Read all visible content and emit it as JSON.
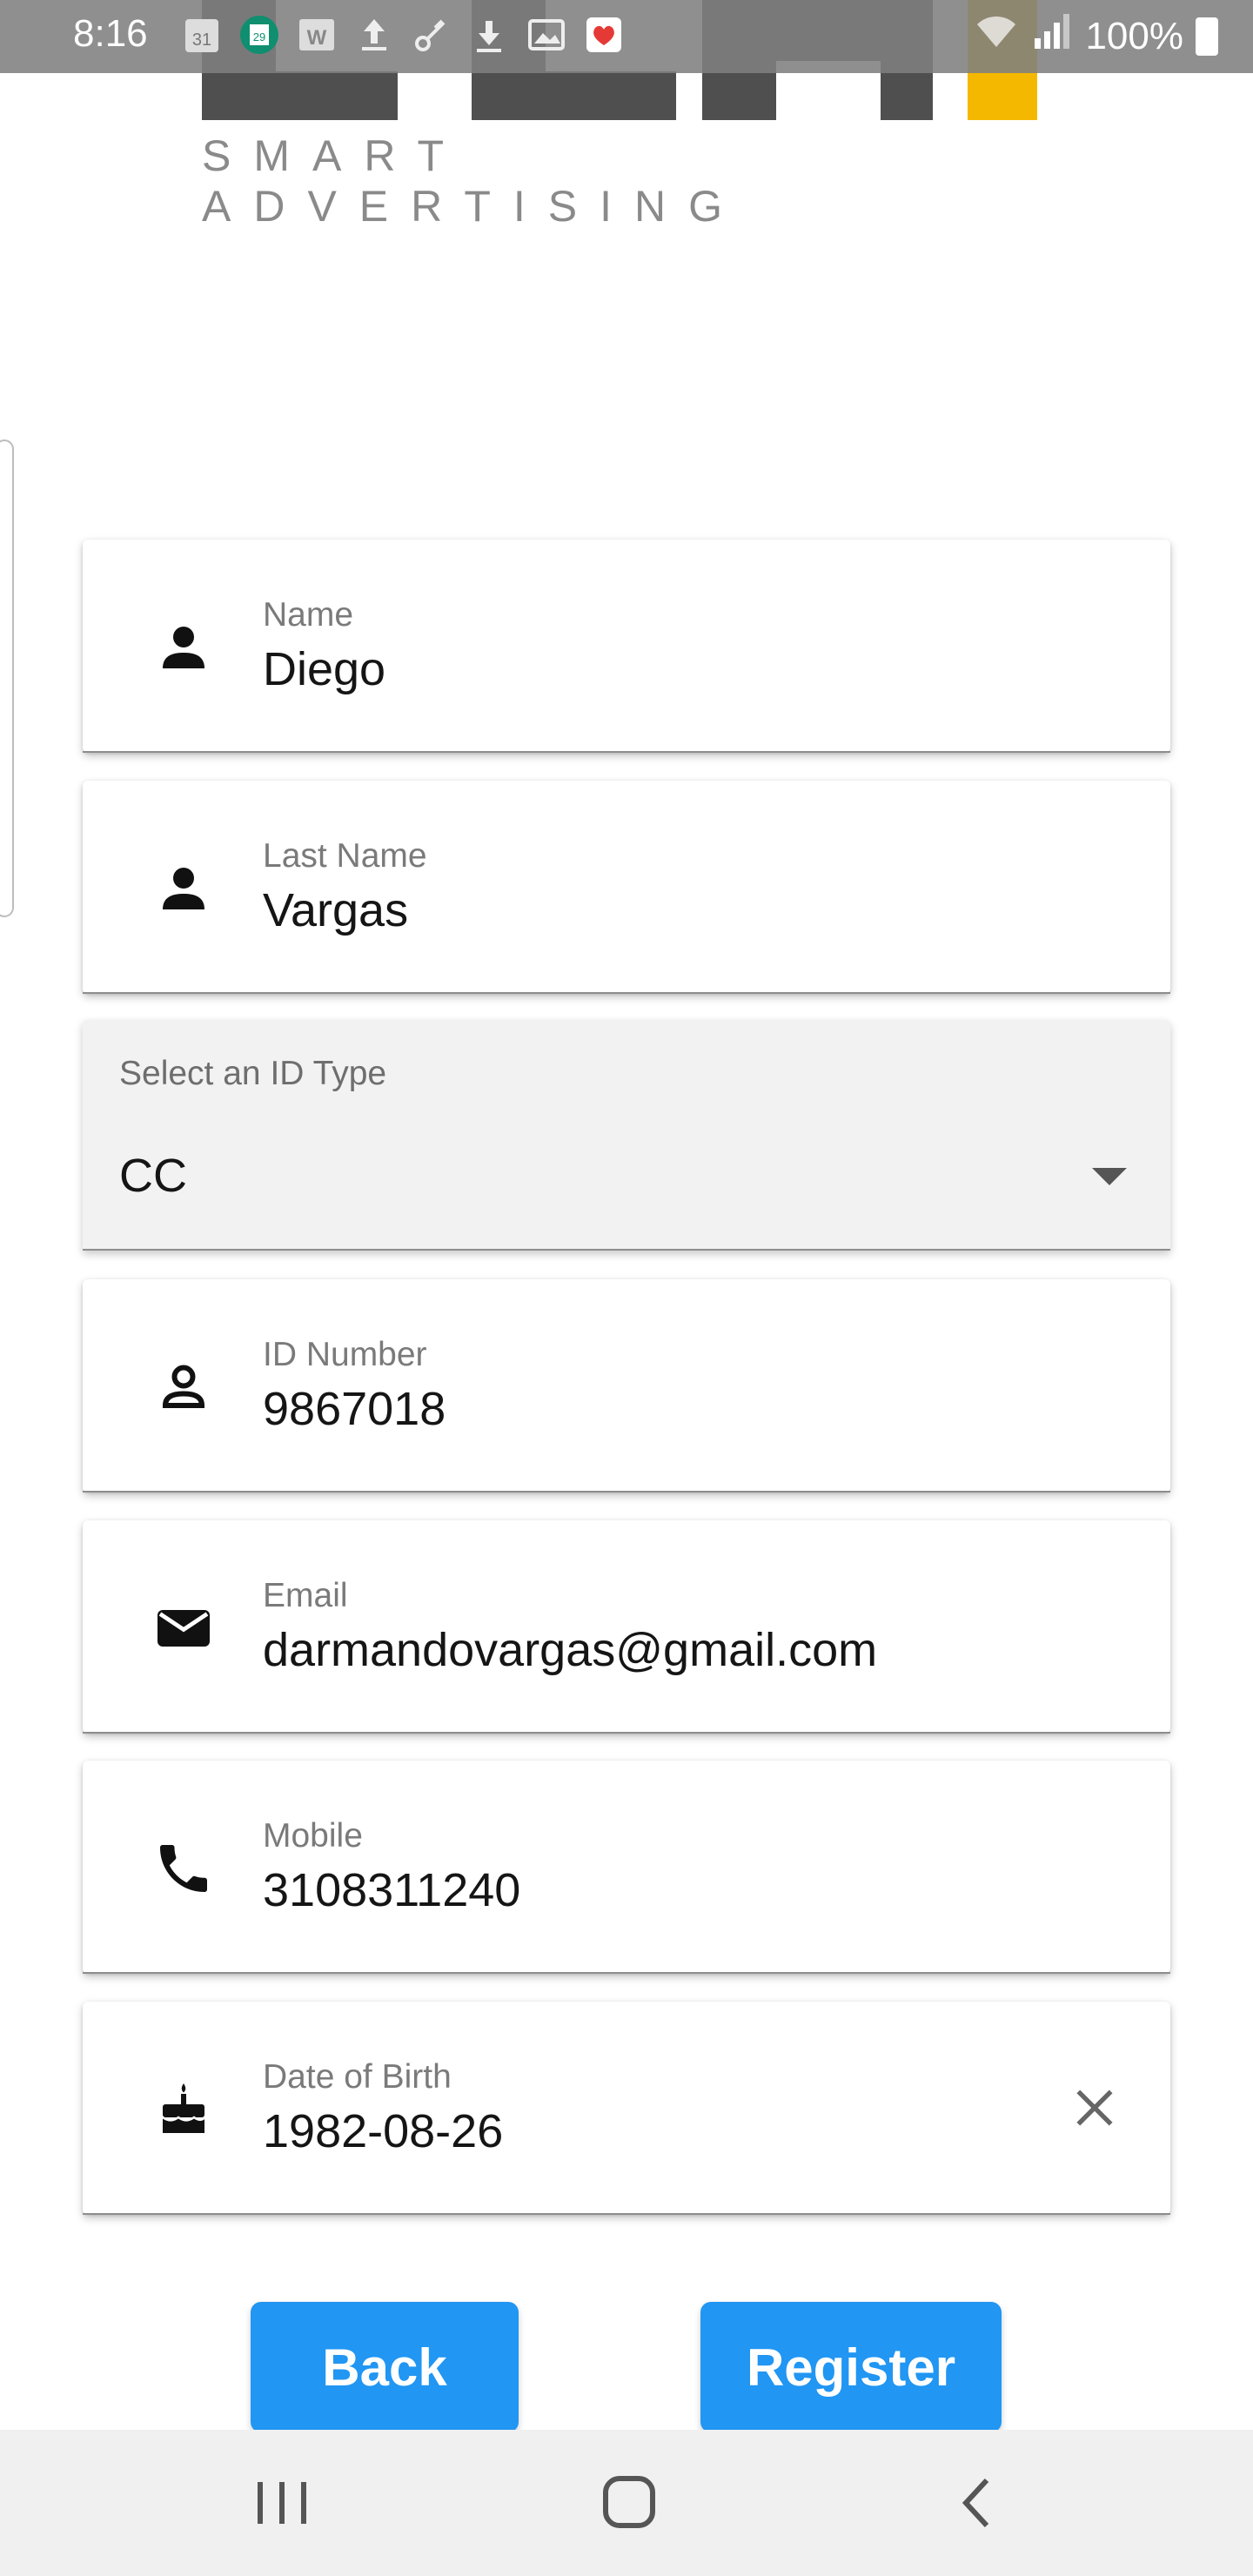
{
  "status_bar": {
    "time": "8:16",
    "battery": "100%",
    "notification_icons": [
      "calendar-31-icon",
      "calendar-29-icon",
      "word-icon",
      "upload-icon",
      "network-icon",
      "download-icon",
      "image-icon",
      "health-icon"
    ]
  },
  "logo": {
    "tagline": "SMART ADVERTISING",
    "colors": {
      "dark": "#4f4f4f",
      "accent": "#f5b800"
    }
  },
  "form": {
    "name": {
      "label": "Name",
      "value": "Diego",
      "icon": "person-icon"
    },
    "last_name": {
      "label": "Last Name",
      "value": "Vargas",
      "icon": "person-icon"
    },
    "id_type": {
      "label": "Select an ID Type",
      "value": "CC"
    },
    "id_number": {
      "label": "ID Number",
      "value": "9867018",
      "icon": "person-outline-icon"
    },
    "email": {
      "label": "Email",
      "value": "darmandovargas@gmail.com",
      "icon": "mail-icon"
    },
    "mobile": {
      "label": "Mobile",
      "value": "3108311240",
      "icon": "phone-icon"
    },
    "dob": {
      "label": "Date of Birth",
      "value": "1982-08-26",
      "icon": "cake-icon"
    }
  },
  "buttons": {
    "back": "Back",
    "register": "Register"
  },
  "theme": {
    "primary": "#2196f3"
  }
}
